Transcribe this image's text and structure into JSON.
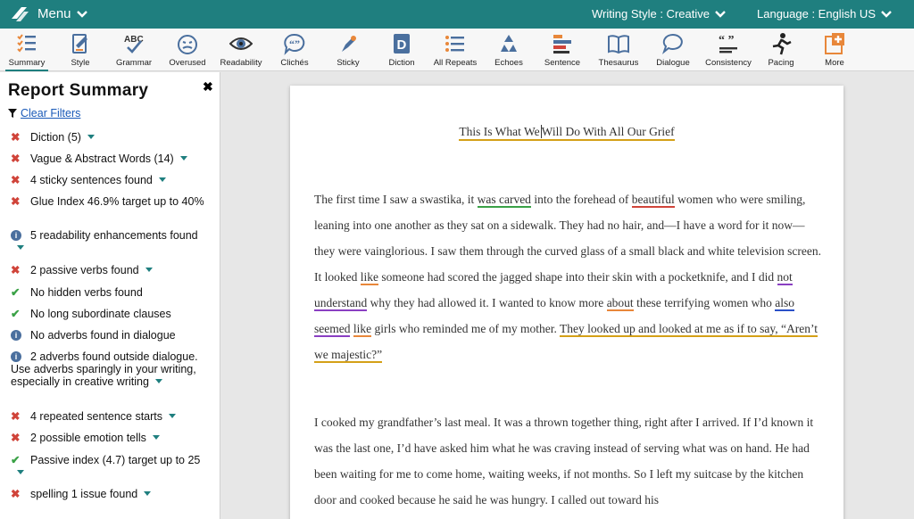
{
  "topbar": {
    "menu_label": "Menu",
    "writing_style": "Writing Style : Creative",
    "language": "Language : English US"
  },
  "toolbar": [
    {
      "label": "Summary",
      "icon": "summary-icon"
    },
    {
      "label": "Style",
      "icon": "style-icon"
    },
    {
      "label": "Grammar",
      "icon": "grammar-icon"
    },
    {
      "label": "Overused",
      "icon": "overused-icon"
    },
    {
      "label": "Readability",
      "icon": "readability-icon"
    },
    {
      "label": "Clichés",
      "icon": "cliches-icon"
    },
    {
      "label": "Sticky",
      "icon": "sticky-icon"
    },
    {
      "label": "Diction",
      "icon": "diction-icon"
    },
    {
      "label": "All Repeats",
      "icon": "all-repeats-icon"
    },
    {
      "label": "Echoes",
      "icon": "echoes-icon"
    },
    {
      "label": "Sentence",
      "icon": "sentence-icon"
    },
    {
      "label": "Thesaurus",
      "icon": "thesaurus-icon"
    },
    {
      "label": "Dialogue",
      "icon": "dialogue-icon"
    },
    {
      "label": "Consistency",
      "icon": "consistency-icon"
    },
    {
      "label": "Pacing",
      "icon": "pacing-icon"
    },
    {
      "label": "More",
      "icon": "more-icon"
    }
  ],
  "sidebar": {
    "title": "Report Summary",
    "clear_filters": "Clear Filters",
    "items": [
      {
        "status": "error",
        "text": "Diction (5)",
        "caret": true
      },
      {
        "status": "error",
        "text": "Vague & Abstract Words (14)",
        "caret": true
      },
      {
        "status": "error",
        "text": "4 sticky sentences found",
        "caret": true
      },
      {
        "status": "error",
        "text": "Glue Index 46.9% target up to 40%",
        "caret": false
      },
      {
        "status": "info",
        "text": "5 readability enhancements found",
        "caret": true
      },
      {
        "status": "error",
        "text": "2 passive verbs found",
        "caret": true
      },
      {
        "status": "ok",
        "text": "No hidden verbs found",
        "caret": false
      },
      {
        "status": "ok",
        "text": "No long subordinate clauses",
        "caret": false
      },
      {
        "status": "info",
        "text": "No adverbs found in dialogue",
        "caret": false
      },
      {
        "status": "info",
        "text": "2 adverbs found outside dialogue. Use adverbs sparingly in your writing, especially in creative writing",
        "caret": true
      },
      {
        "status": "error",
        "text": "4 repeated sentence starts",
        "caret": true
      },
      {
        "status": "error",
        "text": "2 possible emotion tells",
        "caret": true
      },
      {
        "status": "ok",
        "text": "Passive index (4.7) target up to 25",
        "caret": true
      },
      {
        "status": "error",
        "text": "spelling 1 issue found",
        "caret": true
      }
    ]
  },
  "document": {
    "title_a": "This Is What We",
    "title_b": "Will Do With All Our Grief",
    "p1": [
      {
        "t": "The first time I saw a swastika, it "
      },
      {
        "t": "was carved",
        "u": "green"
      },
      {
        "t": " into the forehead of "
      },
      {
        "t": "beautiful",
        "u": "red"
      },
      {
        "t": " women who were smiling, leaning into one another as they sat on a sidewalk. They had no hair, and—I have a word for it now—they were vainglorious. I saw them through the curved glass of a small black and white television screen. It looked "
      },
      {
        "t": "like",
        "u": "orange"
      },
      {
        "t": " someone had scored the jagged shape into their skin with a pocketknife, and I did "
      },
      {
        "t": "not understand",
        "u": "purple"
      },
      {
        "t": " why they had allowed it. I wanted to know more "
      },
      {
        "t": "about",
        "u": "orange"
      },
      {
        "t": " these terrifying women who "
      },
      {
        "t": "also",
        "u": "blue"
      },
      {
        "t": " "
      },
      {
        "t": "seemed",
        "u": "purple"
      },
      {
        "t": " "
      },
      {
        "t": "like",
        "u": "orange"
      },
      {
        "t": " girls who reminded me of my mother. "
      },
      {
        "t": "They looked up and looked at me as if to say, “Aren’t we majestic?”",
        "u": "yellow"
      }
    ],
    "p2": "I cooked my grandfather’s last meal. It was a thrown together thing, right after I arrived. If I’d known it was the last one, I’d have asked him what he was craving instead of serving what was on hand. He had been waiting for me to come home, waiting weeks, if not months. So I left my suitcase by the kitchen door and cooked because he said he was hungry. I called out toward his"
  },
  "colors": {
    "brand": "#1f7f7f",
    "error": "#d0443a",
    "ok": "#3aa146",
    "info": "#4a6f9e"
  }
}
